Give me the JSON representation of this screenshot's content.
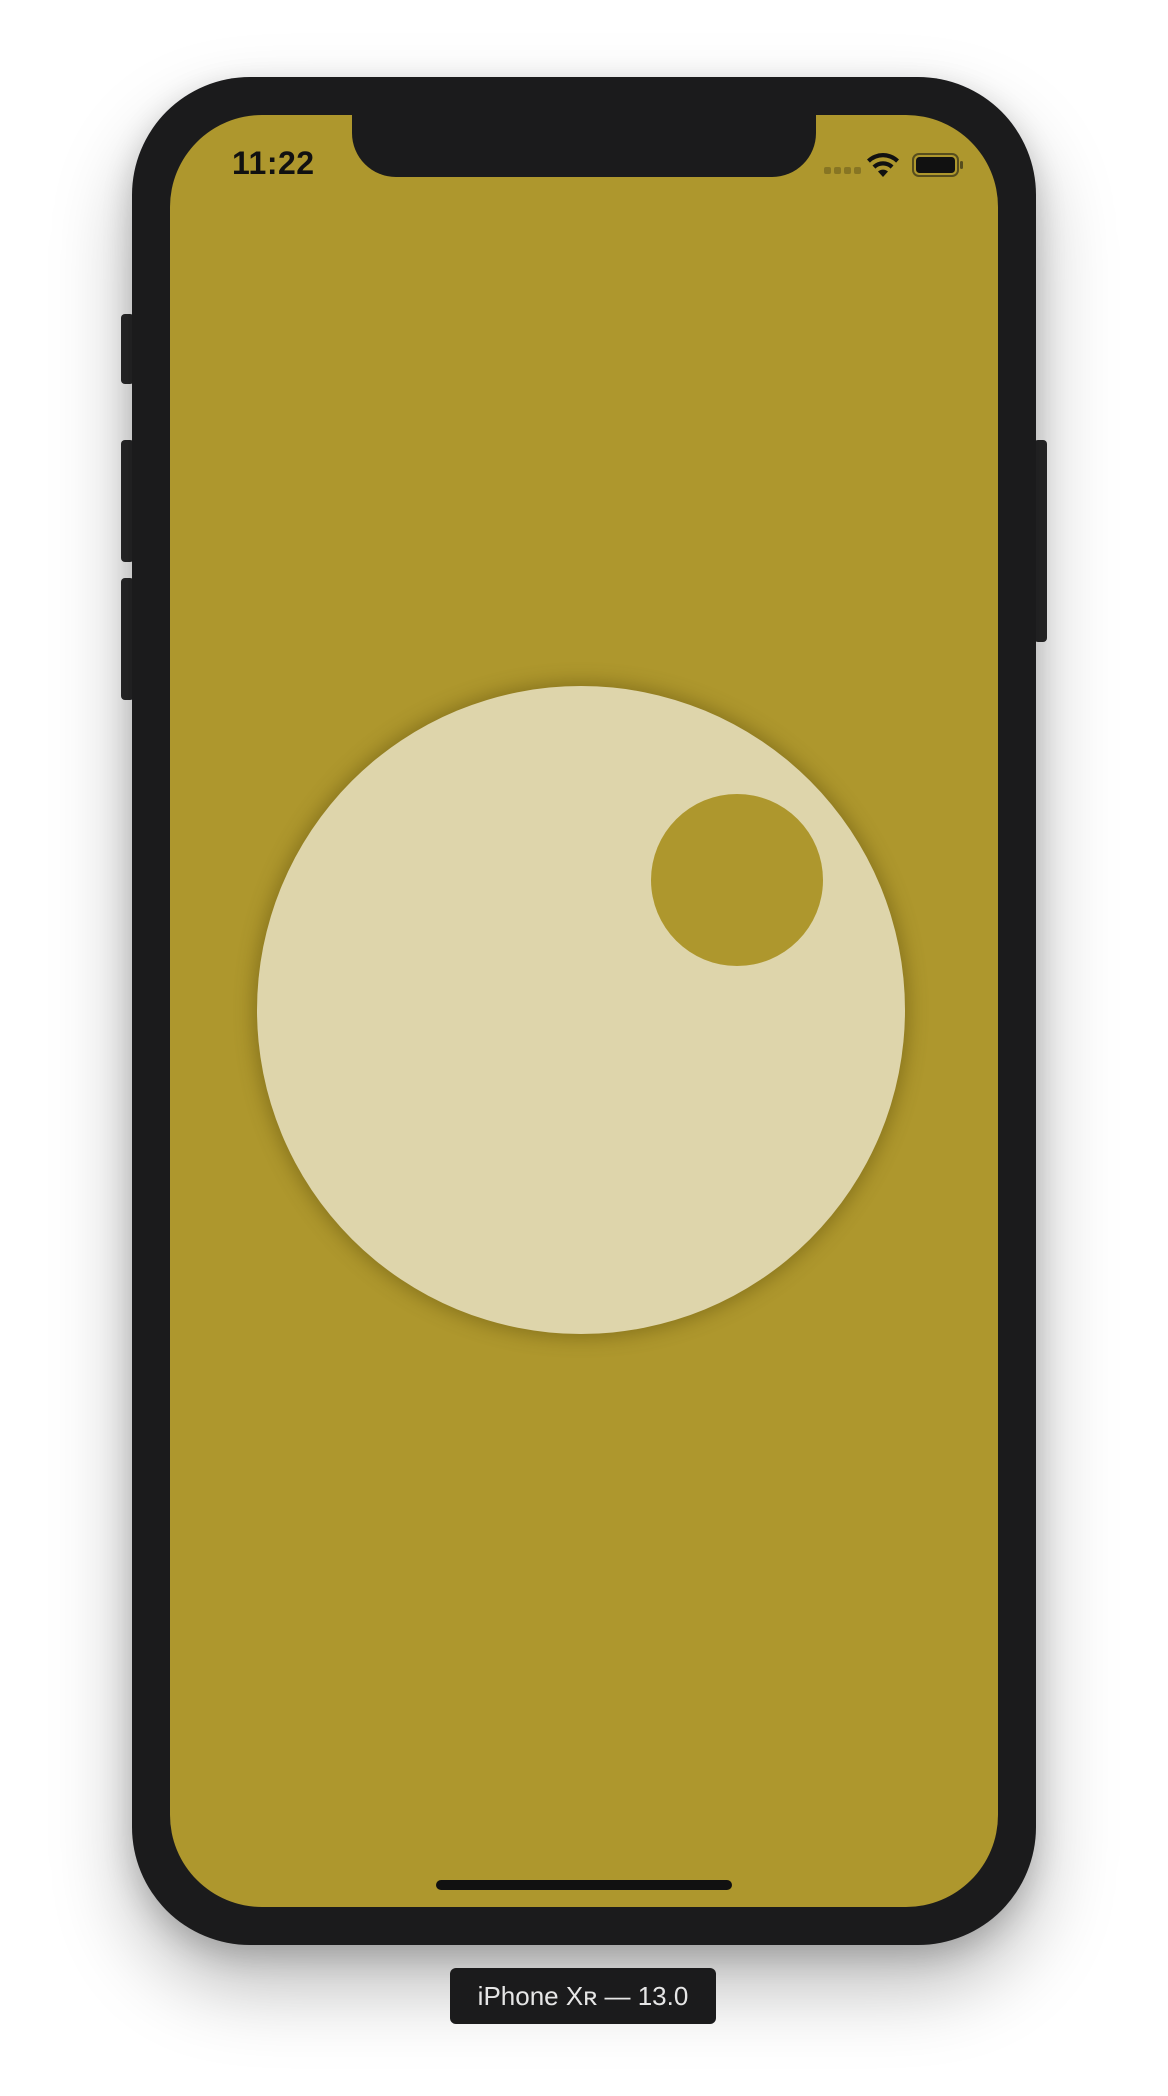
{
  "status_bar": {
    "time": "11:22",
    "icons": [
      "cellular-signal-icon",
      "wifi-icon",
      "battery-icon"
    ]
  },
  "screen": {
    "background_color": "#ae972d",
    "big_circle_color": "#ded5ab",
    "small_circle_color": "#ae972d"
  },
  "device_label": "iPhone Xʀ — 13.0"
}
